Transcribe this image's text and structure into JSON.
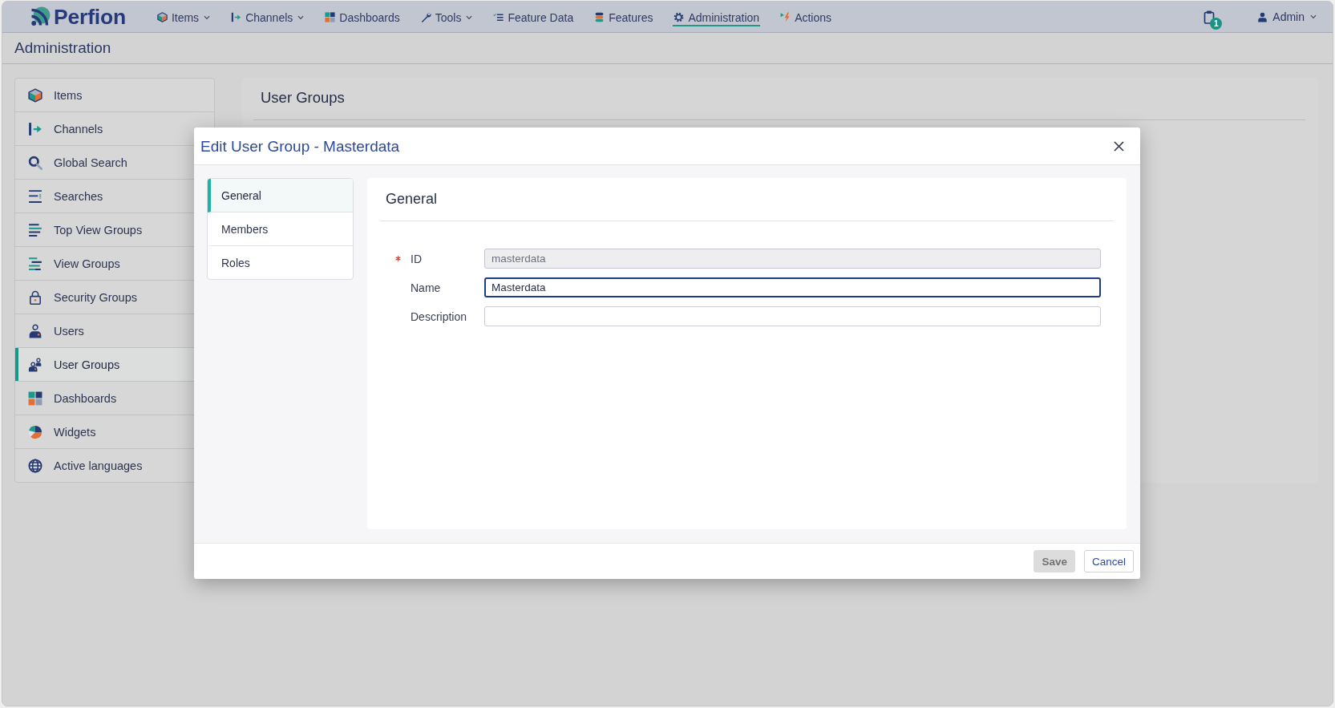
{
  "nav": {
    "logo": "Perfion",
    "items": [
      {
        "label": "Items",
        "dropdown": true,
        "selected": false
      },
      {
        "label": "Channels",
        "dropdown": true,
        "selected": false
      },
      {
        "label": "Dashboards",
        "dropdown": false,
        "selected": false
      },
      {
        "label": "Tools",
        "dropdown": true,
        "selected": false
      },
      {
        "label": "Feature Data",
        "dropdown": false,
        "selected": false
      },
      {
        "label": "Features",
        "dropdown": false,
        "selected": false
      },
      {
        "label": "Administration",
        "dropdown": false,
        "selected": true
      },
      {
        "label": "Actions",
        "dropdown": false,
        "selected": false
      }
    ],
    "notifications": {
      "count": "1"
    },
    "user": {
      "label": "Admin",
      "dropdown": true
    }
  },
  "page_title": "Administration",
  "sidebar": {
    "items": [
      {
        "label": "Items",
        "selected": false
      },
      {
        "label": "Channels",
        "selected": false
      },
      {
        "label": "Global Search",
        "selected": false
      },
      {
        "label": "Searches",
        "selected": false
      },
      {
        "label": "Top View Groups",
        "selected": false
      },
      {
        "label": "View Groups",
        "selected": false
      },
      {
        "label": "Security Groups",
        "selected": false
      },
      {
        "label": "Users",
        "selected": false
      },
      {
        "label": "User Groups",
        "selected": true
      },
      {
        "label": "Dashboards",
        "selected": false
      },
      {
        "label": "Widgets",
        "selected": false
      },
      {
        "label": "Active languages",
        "selected": false
      }
    ]
  },
  "panel": {
    "title": "User Groups"
  },
  "dialog": {
    "title": "Edit User Group - Masterdata",
    "tabs": [
      {
        "label": "General",
        "selected": true
      },
      {
        "label": "Members",
        "selected": false
      },
      {
        "label": "Roles",
        "selected": false
      }
    ],
    "section_title": "General",
    "fields": [
      {
        "label": "ID",
        "value": "masterdata",
        "required": true,
        "disabled": true,
        "focused": false
      },
      {
        "label": "Name",
        "value": "Masterdata",
        "required": false,
        "disabled": false,
        "focused": true
      },
      {
        "label": "Description",
        "required": false,
        "disabled": false,
        "focused": false
      }
    ],
    "buttons": [
      {
        "label": "Save",
        "kind": "primary",
        "disabled": true
      },
      {
        "label": "Cancel",
        "kind": "secondary",
        "disabled": false
      }
    ]
  }
}
